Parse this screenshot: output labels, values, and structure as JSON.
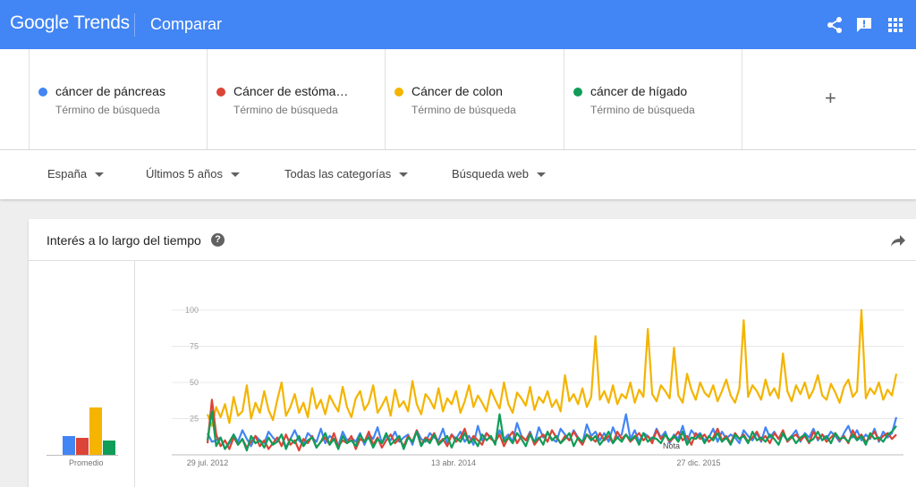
{
  "header": {
    "logo": "Google Trends",
    "section": "Comparar",
    "icons": [
      "share-icon",
      "feedback-icon",
      "apps-icon"
    ]
  },
  "terms": [
    {
      "name": "cáncer de páncreas",
      "type": "Término de búsqueda",
      "color": "#4285f4"
    },
    {
      "name": "Cáncer de estóma…",
      "type": "Término de búsqueda",
      "color": "#db4437"
    },
    {
      "name": "Cáncer de colon",
      "type": "Término de búsqueda",
      "color": "#f4b400"
    },
    {
      "name": "cáncer de hígado",
      "type": "Término de búsqueda",
      "color": "#0f9d58"
    }
  ],
  "add_term": "+",
  "filters": {
    "region": "España",
    "time": "Últimos 5 años",
    "category": "Todas las categorías",
    "property": "Búsqueda web"
  },
  "card": {
    "title": "Interés a lo largo del tiempo",
    "help": "?",
    "avg_label": "Promedio",
    "note": "Nota"
  },
  "chart_data": {
    "type": "line",
    "y_ticks": [
      "100",
      "75",
      "50",
      "25"
    ],
    "ylim": [
      0,
      100
    ],
    "x_labels": [
      "29 jul. 2012",
      "13 abr. 2014",
      "27 dic. 2015"
    ],
    "averages": [
      13,
      12,
      33,
      10
    ],
    "series": [
      {
        "name": "cáncer de páncreas",
        "color": "#4285f4",
        "values": [
          15,
          9,
          10,
          12,
          4,
          8,
          14,
          9,
          17,
          11,
          6,
          13,
          10,
          8,
          16,
          12,
          9,
          14,
          5,
          11,
          17,
          10,
          7,
          15,
          12,
          9,
          18,
          8,
          13,
          11,
          6,
          16,
          10,
          12,
          9,
          15,
          7,
          14,
          11,
          19,
          8,
          13,
          10,
          16,
          9,
          12,
          14,
          7,
          17,
          11,
          9,
          15,
          12,
          10,
          18,
          8,
          14,
          11,
          16,
          9,
          13,
          7,
          20,
          10,
          15,
          12,
          8,
          17,
          11,
          14,
          9,
          22,
          13,
          10,
          16,
          8,
          19,
          12,
          15,
          11,
          9,
          18,
          14,
          10,
          17,
          12,
          8,
          21,
          13,
          16,
          10,
          15,
          9,
          19,
          12,
          14,
          28,
          11,
          17,
          9,
          15,
          13,
          10,
          18,
          12,
          16,
          8,
          14,
          11,
          20,
          9,
          17,
          13,
          15,
          10,
          12,
          18,
          9,
          16,
          11,
          14,
          12,
          8,
          17,
          13,
          10,
          15,
          9,
          19,
          12,
          16,
          11,
          14,
          10,
          13,
          17,
          9,
          15,
          12,
          18,
          10,
          14,
          11,
          16,
          13,
          9,
          15,
          20,
          12,
          17,
          10,
          14,
          11,
          18,
          9,
          16,
          12,
          15,
          26
        ]
      },
      {
        "name": "Cáncer de estómago",
        "color": "#db4437",
        "values": [
          8,
          38,
          14,
          6,
          10,
          4,
          12,
          7,
          11,
          5,
          9,
          13,
          6,
          10,
          4,
          8,
          12,
          6,
          14,
          7,
          10,
          3,
          11,
          8,
          13,
          5,
          9,
          12,
          7,
          15,
          6,
          10,
          8,
          13,
          4,
          11,
          9,
          16,
          7,
          12,
          5,
          10,
          14,
          8,
          11,
          6,
          13,
          9,
          17,
          7,
          12,
          10,
          15,
          8,
          11,
          6,
          14,
          9,
          12,
          18,
          8,
          13,
          10,
          7,
          15,
          11,
          9,
          14,
          6,
          12,
          16,
          8,
          13,
          10,
          15,
          7,
          11,
          14,
          9,
          17,
          12,
          8,
          13,
          10,
          16,
          11,
          7,
          14,
          12,
          9,
          15,
          10,
          13,
          8,
          16,
          11,
          14,
          9,
          12,
          15,
          10,
          13,
          8,
          17,
          11,
          14,
          9,
          12,
          16,
          10,
          13,
          7,
          15,
          11,
          14,
          9,
          12,
          18,
          10,
          13,
          8,
          15,
          11,
          14,
          9,
          12,
          16,
          10,
          13,
          8,
          15,
          11,
          17,
          9,
          12,
          14,
          10,
          13,
          8,
          16,
          11,
          14,
          9,
          12,
          15,
          10,
          13,
          8,
          17,
          11,
          14,
          9,
          12,
          16,
          10,
          13,
          15,
          11,
          14
        ]
      },
      {
        "name": "Cáncer de colon",
        "color": "#f4b400",
        "values": [
          28,
          20,
          33,
          26,
          35,
          22,
          40,
          27,
          30,
          48,
          25,
          36,
          29,
          44,
          31,
          24,
          38,
          50,
          27,
          33,
          42,
          29,
          36,
          26,
          46,
          32,
          38,
          28,
          41,
          35,
          30,
          47,
          33,
          26,
          39,
          44,
          31,
          36,
          48,
          29,
          34,
          40,
          27,
          45,
          33,
          37,
          30,
          51,
          35,
          28,
          42,
          38,
          32,
          46,
          30,
          39,
          35,
          44,
          29,
          37,
          48,
          33,
          41,
          36,
          30,
          45,
          38,
          32,
          50,
          35,
          29,
          43,
          39,
          34,
          47,
          31,
          40,
          36,
          44,
          33,
          38,
          30,
          55,
          37,
          42,
          35,
          46,
          33,
          40,
          82,
          38,
          44,
          36,
          48,
          35,
          42,
          39,
          50,
          36,
          45,
          40,
          87,
          42,
          37,
          48,
          44,
          39,
          74,
          41,
          36,
          56,
          45,
          38,
          50,
          43,
          40,
          48,
          37,
          44,
          52,
          41,
          36,
          46,
          93,
          40,
          48,
          44,
          38,
          52,
          41,
          46,
          39,
          70,
          44,
          37,
          48,
          42,
          50,
          39,
          45,
          55,
          41,
          38,
          49,
          43,
          36,
          47,
          52,
          40,
          44,
          100,
          39,
          46,
          42,
          50,
          38,
          45,
          41,
          56
        ]
      },
      {
        "name": "cáncer de hígado",
        "color": "#0f9d58",
        "values": [
          10,
          30,
          6,
          12,
          4,
          9,
          14,
          7,
          11,
          3,
          13,
          8,
          10,
          5,
          12,
          7,
          9,
          14,
          4,
          11,
          8,
          13,
          6,
          10,
          12,
          5,
          9,
          15,
          7,
          11,
          4,
          13,
          8,
          10,
          6,
          14,
          9,
          12,
          5,
          11,
          8,
          15,
          7,
          10,
          13,
          4,
          12,
          9,
          16,
          6,
          11,
          8,
          14,
          7,
          10,
          13,
          5,
          12,
          9,
          15,
          8,
          11,
          6,
          14,
          10,
          13,
          7,
          28,
          9,
          12,
          8,
          15,
          11,
          6,
          14,
          9,
          12,
          7,
          16,
          10,
          13,
          8,
          11,
          15,
          6,
          12,
          9,
          14,
          10,
          13,
          7,
          11,
          16,
          8,
          12,
          9,
          14,
          10,
          13,
          7,
          15,
          9,
          12,
          11,
          8,
          14,
          10,
          13,
          9,
          16,
          7,
          12,
          11,
          14,
          8,
          13,
          10,
          15,
          9,
          12,
          7,
          14,
          11,
          13,
          8,
          16,
          10,
          12,
          9,
          14,
          11,
          7,
          15,
          10,
          13,
          8,
          12,
          14,
          9,
          11,
          16,
          10,
          13,
          8,
          15,
          11,
          12,
          9,
          14,
          10,
          13,
          7,
          15,
          11,
          12,
          9,
          14,
          16,
          20
        ]
      }
    ]
  }
}
